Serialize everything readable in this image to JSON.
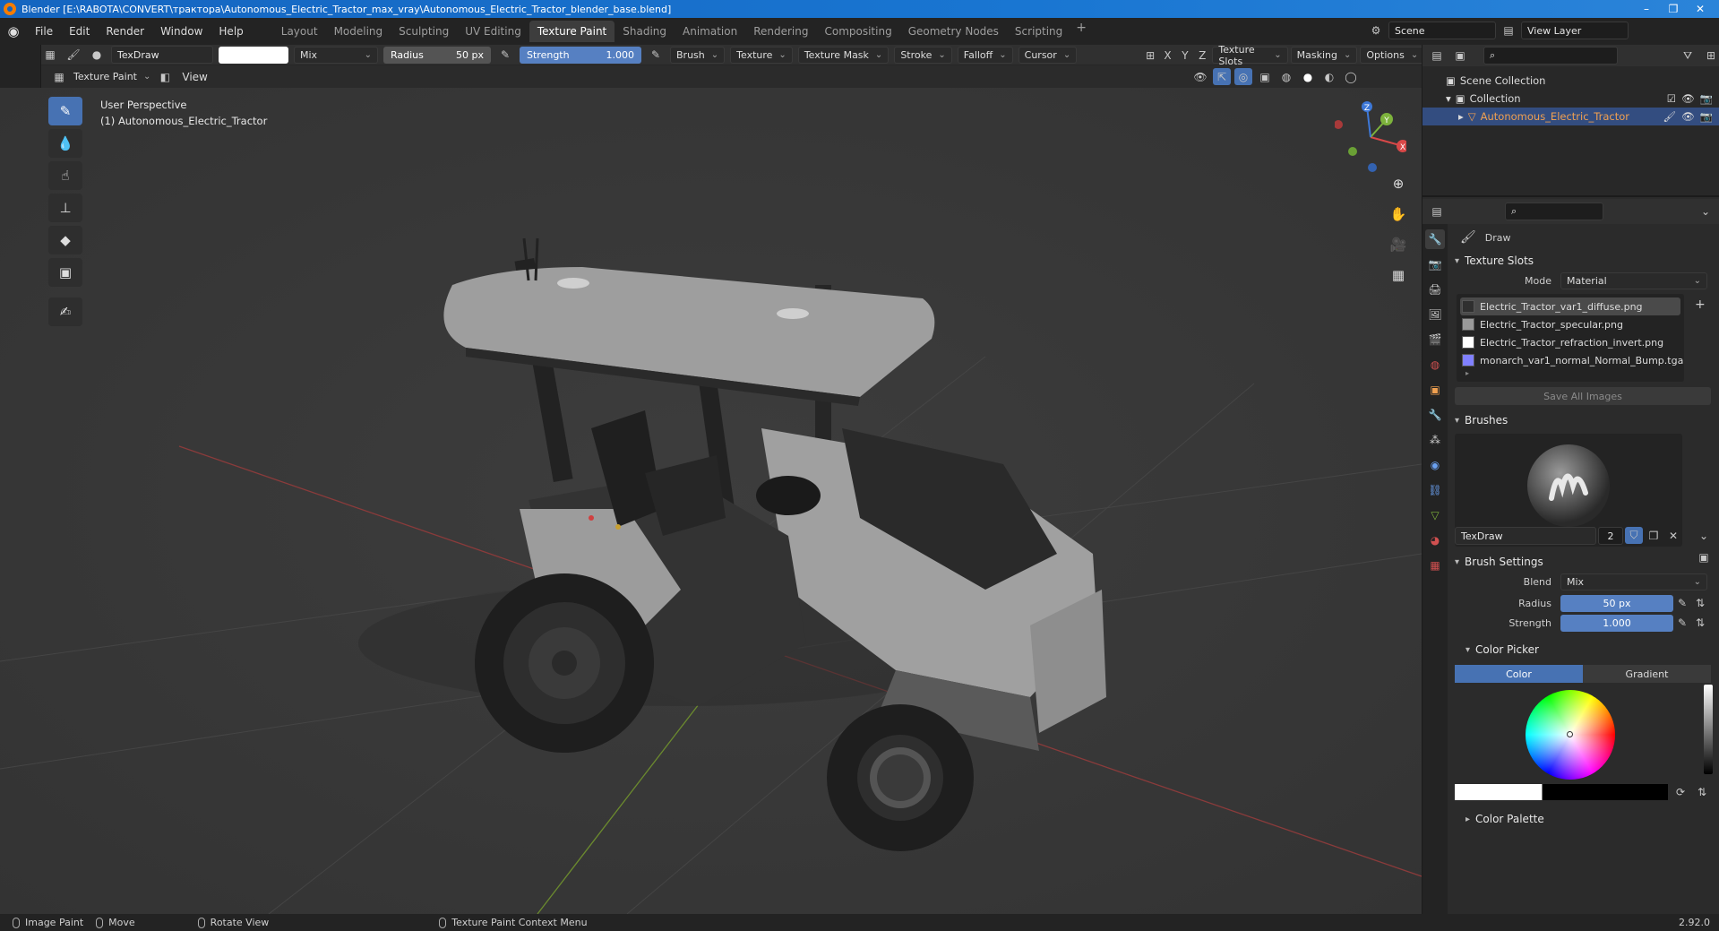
{
  "window": {
    "title": "Blender [E:\\RABOTA\\CONVERT\\тракторa\\Autonomous_Electric_Tractor_max_vray\\Autonomous_Electric_Tractor_blender_base.blend]",
    "minimize": "–",
    "restore": "❐",
    "close": "✕"
  },
  "menubar": {
    "items": [
      "File",
      "Edit",
      "Render",
      "Window",
      "Help"
    ],
    "workspaces": [
      "Layout",
      "Modeling",
      "Sculpting",
      "UV Editing",
      "Texture Paint",
      "Shading",
      "Animation",
      "Rendering",
      "Compositing",
      "Geometry Nodes",
      "Scripting"
    ],
    "active_workspace": "Texture Paint",
    "add": "+",
    "scene": "Scene",
    "view_layer": "View Layer"
  },
  "tool_header": {
    "brush_name": "TexDraw",
    "blend": "Mix",
    "radius_label": "Radius",
    "radius_value": "50 px",
    "strength_label": "Strength",
    "strength_value": "1.000",
    "menus": [
      "Brush",
      "Texture",
      "Texture Mask",
      "Stroke",
      "Falloff",
      "Cursor"
    ],
    "axes": [
      "X",
      "Y",
      "Z"
    ],
    "right_menus": [
      "Texture Slots",
      "Masking",
      "Options"
    ]
  },
  "header2": {
    "mode": "Texture Paint",
    "view": "View"
  },
  "viewport": {
    "perspective": "User Perspective",
    "object": "(1) Autonomous_Electric_Tractor",
    "gizmo_x": "X",
    "gizmo_y": "Y",
    "gizmo_z": "Z"
  },
  "outliner": {
    "scene_collection": "Scene Collection",
    "collection": "Collection",
    "object": "Autonomous_Electric_Tractor"
  },
  "properties": {
    "tool_name": "Draw",
    "texture_slots_header": "Texture Slots",
    "mode_label": "Mode",
    "mode_value": "Material",
    "slots": [
      {
        "name": "Electric_Tractor_var1_diffuse.png",
        "color": "#2f2f2f"
      },
      {
        "name": "Electric_Tractor_specular.png",
        "color": "#9a9a9a"
      },
      {
        "name": "Electric_Tractor_refraction_invert.png",
        "color": "#ffffff"
      },
      {
        "name": "monarch_var1_normal_Normal_Bump.tga",
        "color": "#8080ff"
      }
    ],
    "save_all": "Save All Images",
    "brushes_header": "Brushes",
    "brush_name": "TexDraw",
    "brush_users": "2",
    "brush_settings_header": "Brush Settings",
    "blend_label": "Blend",
    "blend_value": "Mix",
    "radius_label": "Radius",
    "radius_value": "50 px",
    "strength_label": "Strength",
    "strength_value": "1.000",
    "color_picker_header": "Color Picker",
    "color_tab": "Color",
    "gradient_tab": "Gradient",
    "color_palette_header": "Color Palette"
  },
  "statusbar": {
    "image_paint": "Image Paint",
    "move": "Move",
    "rotate": "Rotate View",
    "context": "Texture Paint Context Menu",
    "version": "2.92.0"
  }
}
